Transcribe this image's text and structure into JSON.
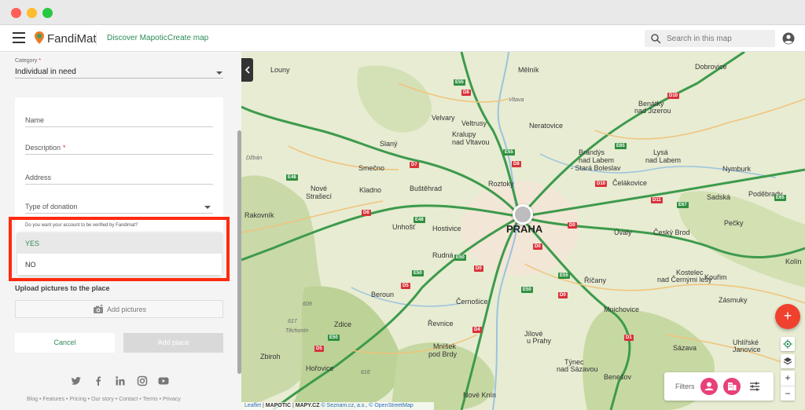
{
  "header": {
    "brand": "FandiMat",
    "nav": [
      "Discover Mapotic",
      "Create map"
    ],
    "search_placeholder": "Search in this map"
  },
  "form": {
    "category_label": "Category",
    "required_mark": "*",
    "category_value": "Individual in need",
    "fields": [
      "Name",
      "Description",
      "Address",
      "Type of donation"
    ],
    "verify_question": "Do you want your account to be verified by Fandimat?",
    "options": [
      "YES",
      "NO"
    ],
    "selected_option": "YES",
    "upload_title": "Upload pictures to the place",
    "add_pictures": "Add pictures",
    "cancel": "Cancel",
    "add_place": "Add place"
  },
  "footer": {
    "links": [
      "Blog",
      "Features",
      "Pricing",
      "Our story",
      "Contact",
      "Terms",
      "Privacy"
    ],
    "separator": " • "
  },
  "map": {
    "cities": {
      "praha": "PRAHA",
      "melnik": "Mělník",
      "louny": "Louny",
      "slany": "Slaný",
      "kladno": "Kladno",
      "velvary": "Velvary",
      "veltrusy": "Veltrusy",
      "kralupy1": "Kralupy",
      "kralupy2": "nad Vltavou",
      "neratovice": "Neratovice",
      "brandys1": "Brandýs",
      "brandys2": "nad Labem",
      "brandys3": "- Stará Boleslav",
      "benatky1": "Benátky",
      "benatky2": "nad Jizerou",
      "lysa1": "Lysá",
      "lysa2": "nad Labem",
      "dobrovice": "Dobrovice",
      "nymburk": "Nymburk",
      "celakovice": "Čelákovice",
      "sadska": "Sadská",
      "podebrady": "Poděbrady",
      "pecky": "Pečky",
      "cesky_brod": "Český Brod",
      "uvaly": "Úvaly",
      "kostelec1": "Kostelec",
      "kostelec2": "nad Černými lesy",
      "kourim": "Kouřim",
      "ricany": "Říčany",
      "zasmuky": "Zásmuky",
      "mnichovice": "Mnichovice",
      "benesov": "Benešov",
      "sazava": "Sázava",
      "uhlirske1": "Uhlířské",
      "uhlirske2": "Janovice",
      "kolin": "Kolín",
      "roztoky": "Roztoky",
      "bustehrad": "Buštěhrad",
      "smecno": "Smečno",
      "nove_straseci1": "Nové",
      "nove_straseci2": "Strašecí",
      "rakovnik": "Rakovník",
      "unhost": "Unhošť",
      "hostivice": "Hostivice",
      "rudna": "Rudná",
      "beroun": "Beroun",
      "cernosice": "Černošice",
      "revnice": "Řevnice",
      "zdice": "Zdice",
      "zbiroh": "Zbiroh",
      "horovice": "Hořovice",
      "jilove1": "Jílové",
      "jilove2": "u Prahy",
      "mnisek1": "Mníšek",
      "mnisek2": "pod Brdy",
      "tynec1": "Týnec",
      "tynec2": "nad Sázavou",
      "nove_kniny": "Nové Knín",
      "vltava": "Vltava",
      "deban": "Džbán",
      "tychonin": "Těchonín",
      "h609": "609",
      "h617": "617",
      "h616": "616"
    },
    "roads": {
      "e55a": "E55",
      "e55b": "E55",
      "e55c": "E55",
      "e65a": "E65",
      "e65b": "E65",
      "e67": "E67",
      "e48a": "E48",
      "e48b": "E48",
      "e50a": "E50",
      "e50b": "E50",
      "e50c": "E50",
      "e50d": "E50",
      "e55d": "E55",
      "d8a": "D8",
      "d8b": "D8",
      "d10a": "D10",
      "d10b": "D10",
      "d11": "D11",
      "d7": "D7",
      "d6": "D6",
      "d0a": "D0",
      "d0b": "D0",
      "d0c": "D0",
      "d0d": "D0",
      "d5a": "D5",
      "d5b": "D5",
      "d4": "D4",
      "d1": "D1"
    },
    "filters_label": "Filters",
    "fab_label": "+",
    "zoom_in": "+",
    "zoom_out": "−",
    "attribution": {
      "leaflet": "Leaflet",
      "mapotic": "MAPOTIC",
      "mapy": "MAPY.CZ",
      "copy": "© Seznam.cz, a.s., © OpenStreetMap"
    }
  },
  "colors": {
    "accent": "#2e8b57",
    "highlight": "#ff2a10",
    "fab": "#f0402e",
    "filter_chip": "#e8407a"
  }
}
